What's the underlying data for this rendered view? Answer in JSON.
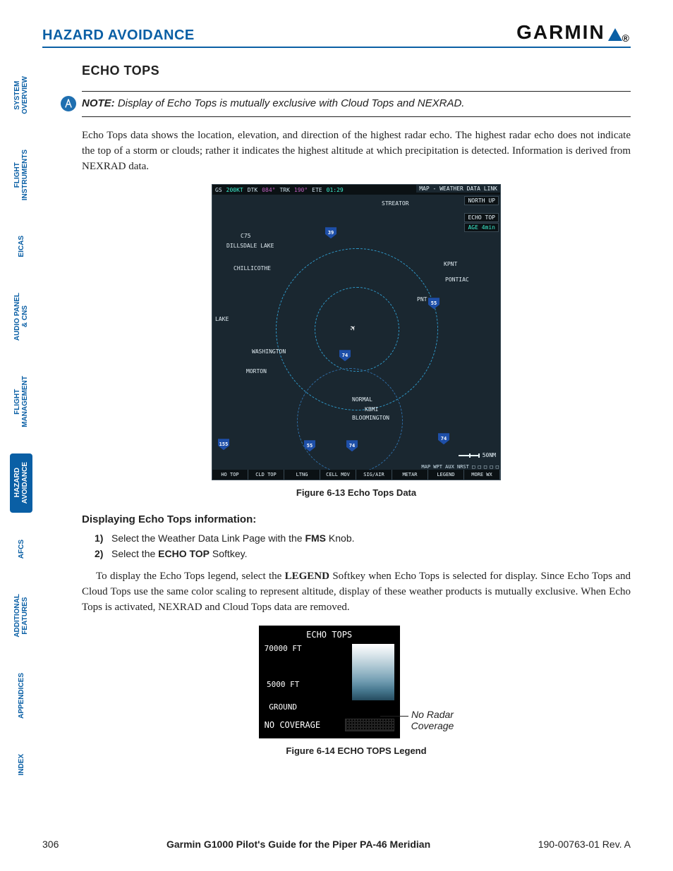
{
  "header": {
    "section": "HAZARD AVOIDANCE",
    "brand": "GARMIN"
  },
  "tabs": [
    {
      "label": "SYSTEM\nOVERVIEW",
      "active": false
    },
    {
      "label": "FLIGHT\nINSTRUMENTS",
      "active": false
    },
    {
      "label": "EICAS",
      "active": false
    },
    {
      "label": "AUDIO PANEL\n& CNS",
      "active": false
    },
    {
      "label": "FLIGHT\nMANAGEMENT",
      "active": false
    },
    {
      "label": "HAZARD\nAVOIDANCE",
      "active": true
    },
    {
      "label": "AFCS",
      "active": false
    },
    {
      "label": "ADDITIONAL\nFEATURES",
      "active": false
    },
    {
      "label": "APPENDICES",
      "active": false
    },
    {
      "label": "INDEX",
      "active": false
    }
  ],
  "topic": "ECHO TOPS",
  "note": {
    "label": "NOTE:",
    "text": "Display of Echo Tops is mutually exclusive with Cloud Tops and NEXRAD."
  },
  "para1": "Echo Tops data shows the location, elevation, and direction of the highest radar echo.  The highest radar echo does not indicate the top of a storm or clouds; rather it indicates the highest altitude at which precipitation is detected.  Information is derived from NEXRAD data.",
  "map": {
    "top": {
      "gs_label": "GS",
      "gs": "200KT",
      "dtk_label": "DTK",
      "dtk": "084°",
      "trk_label": "TRK",
      "trk": "190°",
      "ete_label": "ETE",
      "ete": "01:29"
    },
    "title": "MAP - WEATHER DATA LINK",
    "north": "NORTH UP",
    "layer": "ECHO TOP",
    "age": "AGE   4min",
    "cities": {
      "streator": "STREATOR",
      "c75": "C75",
      "dillsdale": "DILLSDALE LAKE",
      "chillicothe": "CHILLICOTHE",
      "kpnt": "KPNT",
      "pontiac": "PONTIAC",
      "pnt": "PNT",
      "lake": "LAKE",
      "washington": "WASHINGTON",
      "morton": "MORTON",
      "normal": "NORMAL",
      "kbmi": "KBMI",
      "bloomington": "BLOOMINGTON"
    },
    "hwy": {
      "a": "39",
      "b": "55",
      "c": "74",
      "d": "74",
      "e": "55",
      "f": "74",
      "g": "155"
    },
    "scale": "50NM",
    "aux": "MAP WPT AUX NRST □ □ □ □ □",
    "softkeys": [
      "HO TOP",
      "CLD TOP",
      "LTNG",
      "CELL MOV",
      "SIG/AIR",
      "METAR",
      "LEGEND",
      "MORE WX"
    ]
  },
  "fig1_caption": "Figure 6-13  Echo Tops Data",
  "procedure_title": "Displaying Echo Tops information:",
  "steps": [
    {
      "n": "1)",
      "pre": "Select the Weather Data Link Page with the ",
      "b": "FMS",
      "post": " Knob."
    },
    {
      "n": "2)",
      "pre": "Select the ",
      "b": "ECHO TOP",
      "post": " Softkey."
    }
  ],
  "para2_pre": "To display the Echo Tops legend, select the ",
  "para2_b": "LEGEND",
  "para2_post": " Softkey when Echo Tops is selected for display.  Since Echo Tops and Cloud Tops use the same color scaling to represent altitude, display of these weather products is mutually exclusive.  When Echo Tops is activated, NEXRAD and Cloud Tops data are removed.",
  "legend": {
    "title": "ECHO TOPS",
    "top": "70000 FT",
    "mid": "5000 FT",
    "ground": "GROUND",
    "nocov": "NO COVERAGE",
    "callout": "No Radar\nCoverage"
  },
  "fig2_caption": "Figure 6-14  ECHO TOPS Legend",
  "footer": {
    "page": "306",
    "guide": "Garmin G1000 Pilot's Guide for the Piper PA-46 Meridian",
    "rev": "190-00763-01  Rev. A"
  }
}
